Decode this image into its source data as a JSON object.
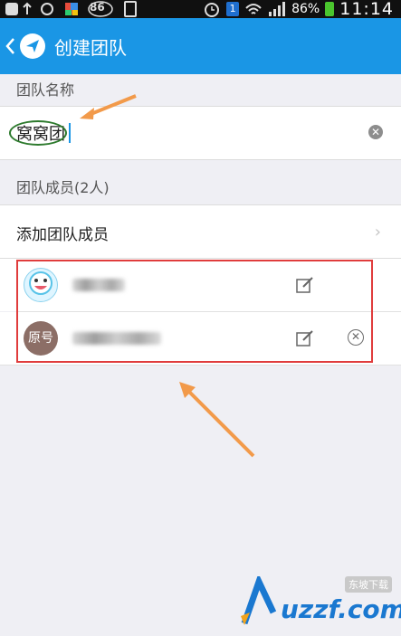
{
  "status_bar": {
    "battery_badge": "86",
    "notification_count": "1",
    "battery_percent": "86%",
    "time": "11:14"
  },
  "header": {
    "title": "创建团队"
  },
  "team_name_section": {
    "heading": "团队名称",
    "value": "窝窝团"
  },
  "members_section": {
    "heading": "团队成员(2人)",
    "add_label": "添加团队成员",
    "members": [
      {
        "avatar_text": ""
      },
      {
        "avatar_text": "原号"
      }
    ]
  },
  "watermark": {
    "text": "uzzf.com",
    "badge": "东坡下载"
  },
  "colors": {
    "accent": "#1a96e5",
    "highlight_box": "#e03c3c",
    "annotation_arrow": "#f29a4a",
    "annotation_circle": "#2d7a2d"
  }
}
